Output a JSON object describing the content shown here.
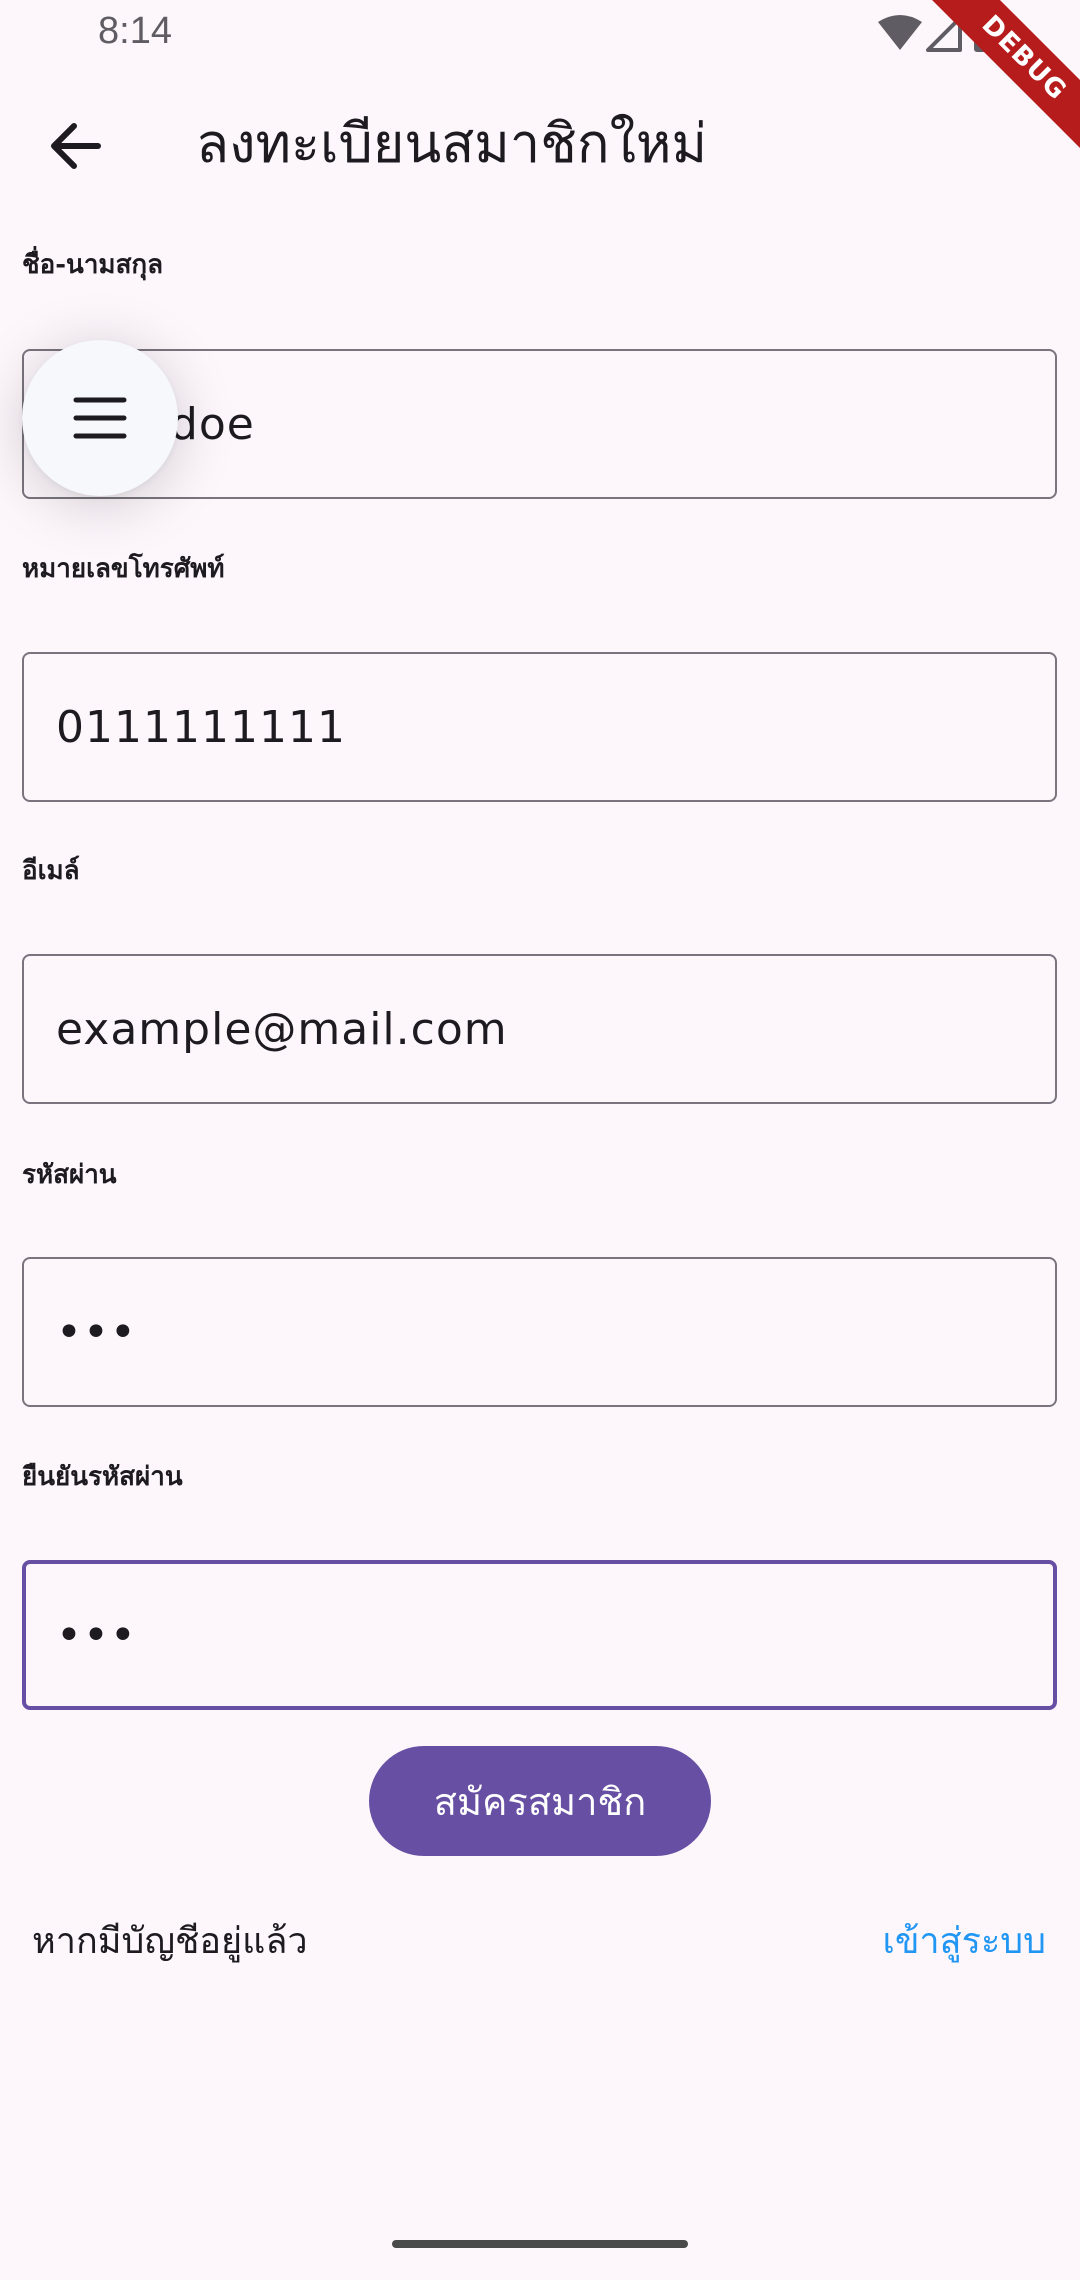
{
  "status_bar": {
    "time": "8:14",
    "icons": [
      "wifi-icon",
      "signal-icon",
      "battery-icon"
    ]
  },
  "debug_banner": "DEBUG",
  "app_bar": {
    "back_icon": "arrow-back-icon",
    "title": "ลงทะเบียนสมาชิกใหม่"
  },
  "form": {
    "fullname": {
      "label": "ชื่อ-นามสกุล",
      "value": "john doe"
    },
    "phone": {
      "label": "หมายเลขโทรศัพท์",
      "value": "0111111111"
    },
    "email": {
      "label": "อีเมล์",
      "value": "example@mail.com"
    },
    "password": {
      "label": "รหัสผ่าน",
      "value": "•••"
    },
    "confirm_password": {
      "label": "ยืนยันรหัสผ่าน",
      "value": "•••"
    }
  },
  "fab": {
    "icon": "menu-icon"
  },
  "register_button": "สมัครสมาชิก",
  "footer": {
    "have_account": "หากมีบัญชีอยู่แล้ว",
    "login_link": "เข้าสู่ระบบ"
  },
  "colors": {
    "background": "#fdf7fc",
    "primary": "#6750a4",
    "link": "#2196f3",
    "outline": "#79747e",
    "debug_banner": "#b71c1c"
  }
}
